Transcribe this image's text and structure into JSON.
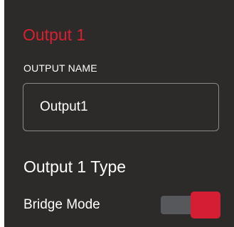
{
  "output": {
    "title": "Output 1",
    "name_label": "OUTPUT NAME",
    "name_value": "Output1",
    "type_heading": "Output 1 Type",
    "bridge_mode_label": "Bridge Mode",
    "bridge_mode_on": true
  },
  "colors": {
    "accent": "#d92030",
    "panel_bg": "#2c2b2a",
    "toggle_track": "#57585b",
    "toggle_knob": "#d51e33"
  }
}
